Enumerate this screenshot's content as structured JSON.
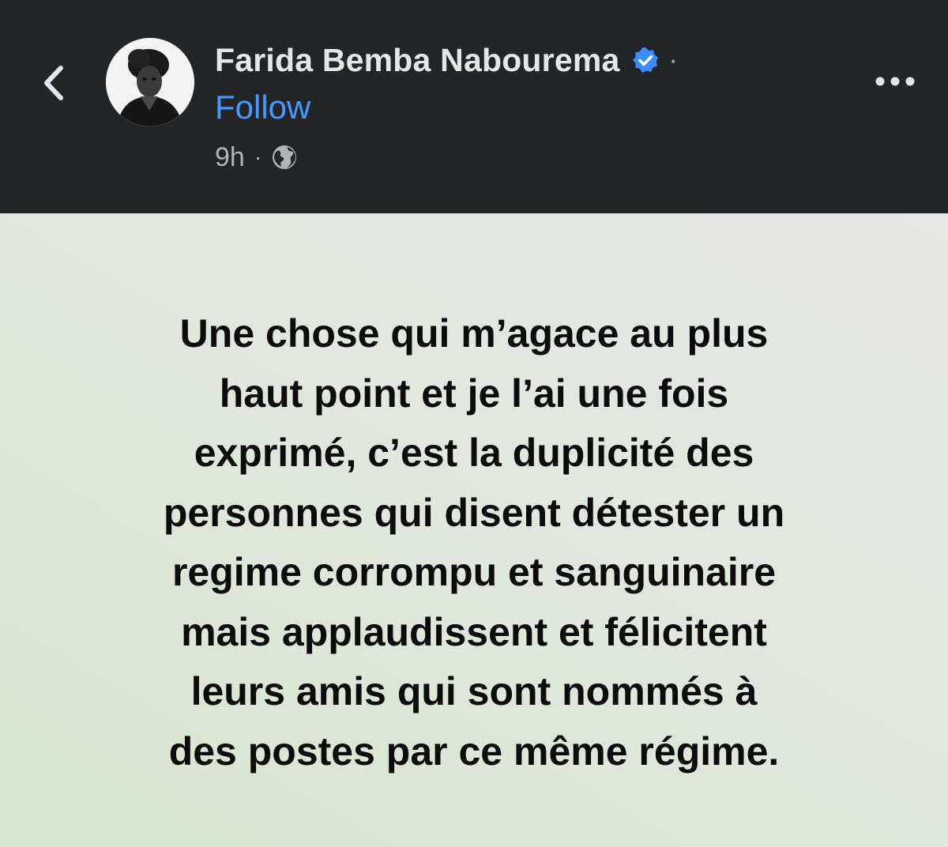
{
  "header": {
    "author_name": "Farida Bemba Nabourema",
    "separator": "·",
    "follow_label": "Follow",
    "time": "9h",
    "time_separator": "·",
    "icons": {
      "back": "chevron-left-icon",
      "verified": "verified-badge-icon",
      "privacy": "globe-icon",
      "more": "more-horizontal-icon"
    },
    "colors": {
      "header_bg": "#242526",
      "follow": "#4599ff",
      "verified": "#3b8cff"
    }
  },
  "post": {
    "lines": [
      "Une chose qui m’agace au plus",
      "haut point et je l’ai une fois",
      "exprimé, c’est la duplicité des",
      "personnes qui disent détester un",
      "regime corrompu et sanguinaire",
      "mais applaudissent et félicitent",
      "leurs amis qui sont nommés à",
      "des postes par ce même régime."
    ],
    "colors": {
      "bg_top": "#e7e7e5",
      "bg_bottom": "#d7e6cc",
      "text": "#0c0c0c"
    }
  }
}
